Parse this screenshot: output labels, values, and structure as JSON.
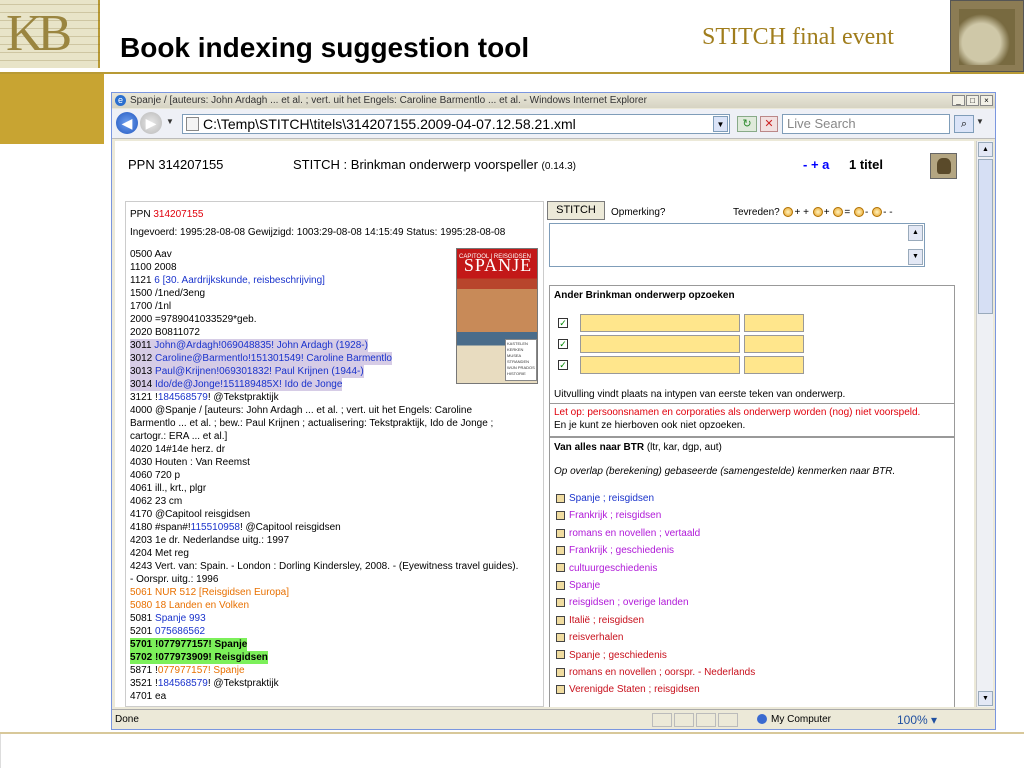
{
  "slide": {
    "logo_text": "KB",
    "title": "Book indexing suggestion tool",
    "event": "STITCH final event"
  },
  "browser": {
    "window_title": "Spanje / [auteurs: John Ardagh ... et al. ; vert. uit het Engels: Caroline Barmentlo ... et al. - Windows Internet Explorer",
    "url": "C:\\Temp\\STITCH\\titels\\314207155.2009-04-07.12.58.21.xml",
    "search_placeholder": "Live Search",
    "status_text": "Done",
    "zone": "My Computer",
    "zoom": "100%"
  },
  "app": {
    "ppn_heading": "PPN 314207155",
    "tool_title": "STITCH : Brinkman onderwerp voorspeller",
    "version": "(0.14.3)",
    "links": "- + a",
    "titel_count": "1 titel"
  },
  "record": {
    "ppn_label": "PPN",
    "ppn_value": "314207155",
    "ingevoerd": "Ingevoerd: 1995:28-08-08 Gewijzigd: 1003:29-08-08 14:15:49 Status: 1995:28-08-08",
    "lines": [
      {
        "t": "0500 Aav"
      },
      {
        "t": "1100 2008"
      },
      {
        "t": "1121 ",
        "b": "6 [30. Aardrijkskunde, reisbeschrijving]"
      },
      {
        "t": "1500 /1ned/3eng"
      },
      {
        "t": "1700 /1nl"
      },
      {
        "t": "2000 =9789041033529*geb."
      },
      {
        "t": "2020 B0811072"
      },
      {
        "t": "3011 ",
        "b": "John@Ardagh!",
        "c": "069048835",
        "d": "! John Ardagh (1928-)"
      },
      {
        "t": "3012 ",
        "b": "Caroline@Barmentlo!",
        "c": "151301549",
        "d": "! Caroline Barmentlo"
      },
      {
        "t": "3013 ",
        "b": "Paul@Krijnen!",
        "c": "069301832",
        "d": "! Paul Krijnen (1944-)"
      },
      {
        "t": "3014 ",
        "b": "Ido/de@Jonge!",
        "c": "151189485",
        "d": "X! Ido de Jonge"
      },
      {
        "t": "3121 !",
        "b": "184568579",
        "d": "! @Tekstpraktijk"
      },
      {
        "t": "4000 @Spanje / [auteurs: John Ardagh ... et al. ; vert. uit het Engels: Caroline"
      },
      {
        "t": "  Barmentlo ... et al. ; bew.: Paul Krijnen ; actualisering: Tekstpraktijk, Ido de Jonge ;"
      },
      {
        "t": "  cartogr.: ERA ... et al.]"
      },
      {
        "t": "4020 14#14e herz. dr"
      },
      {
        "t": "4030 Houten : Van Reemst"
      },
      {
        "t": "4060 720 p"
      },
      {
        "t": "4061 ill., krt., plgr"
      },
      {
        "t": "4062 23 cm"
      },
      {
        "t": "4170 @Capitool reisgidsen"
      },
      {
        "t": "4180 #span#!",
        "b": "115510958",
        "d": "! @Capitool reisgidsen"
      },
      {
        "t": "4203 1e dr. Nederlandse uitg.: 1997"
      },
      {
        "t": "4204 Met reg"
      },
      {
        "t": "4243 Vert. van: Spain. - London : Dorling Kindersley, 2008. - (Eyewitness travel guides)."
      },
      {
        "t": "  - Oorspr. uitg.: 1996"
      },
      {
        "t": "5061 NUR 512 [Reisgidsen Europa]"
      },
      {
        "t": "5080 18 Landen en Volken"
      },
      {
        "t": "5081 ",
        "b": "Spanje 993"
      },
      {
        "t": "5201 ",
        "b": "075686562"
      },
      {
        "t": "5701 !077977157! Spanje"
      },
      {
        "t": "5702 !077973909! Reisgidsen"
      },
      {
        "t": "5871 !",
        "b": "077977157! Spanje"
      },
      {
        "t": "3521 !",
        "b": "184568579",
        "d": "! @Tekstpraktijk"
      },
      {
        "t": "4701 ea"
      }
    ],
    "cover_brand": "CAPITOOL | REISGIDSEN",
    "cover_title": "SPANJE",
    "cover_blurb": "KASTELEN KERKEN MUSEA STRANDEN WIJN PRADOS HISTORIE"
  },
  "panel": {
    "stitch_button": "STITCH",
    "opmerking": "Opmerking?",
    "tevreden": "Tevreden?",
    "rating_labels": [
      "+ +",
      "+",
      "=",
      "-",
      "- -"
    ],
    "lookup_title": "Ander Brinkman onderwerp opzoeken",
    "lookup_checks": [
      "✓",
      "✓",
      "✓"
    ],
    "note1": "Uitvulling vindt plaats na intypen van eerste teken van onderwerp.",
    "note2": "Let op: persoonsnamen en corporaties als onderwerp worden (nog) niet voorspeld.",
    "note3": "En je kunt ze hierboven ook niet opzoeken.",
    "btr_title": "Van alles naar BTR",
    "btr_title_suffix": " (ltr, kar, dgp, aut)",
    "btr_note": "Op overlap (berekening) gebaseerde (samengestelde) kenmerken naar BTR.",
    "btr_items": [
      {
        "label": "Spanje ; reisgidsen",
        "color": "#1a33cc"
      },
      {
        "label": "Frankrijk ; reisgidsen",
        "color": "#b01ad8"
      },
      {
        "label": "romans en novellen ; vertaald",
        "color": "#b01ad8"
      },
      {
        "label": "Frankrijk ; geschiedenis",
        "color": "#b01ad8"
      },
      {
        "label": "cultuurgeschiedenis",
        "color": "#b01ad8"
      },
      {
        "label": "Spanje",
        "color": "#b01ad8"
      },
      {
        "label": "reisgidsen ; overige landen",
        "color": "#b01ad8"
      },
      {
        "label": "Italië ; reisgidsen",
        "color": "#c8101c"
      },
      {
        "label": "reisverhalen",
        "color": "#c8101c"
      },
      {
        "label": "Spanje ; geschiedenis",
        "color": "#c8101c"
      },
      {
        "label": "romans en novellen ; oorspr. - Nederlands",
        "color": "#c8101c"
      },
      {
        "label": "Verenigde Staten ; reisgidsen",
        "color": "#c8101c"
      }
    ]
  }
}
